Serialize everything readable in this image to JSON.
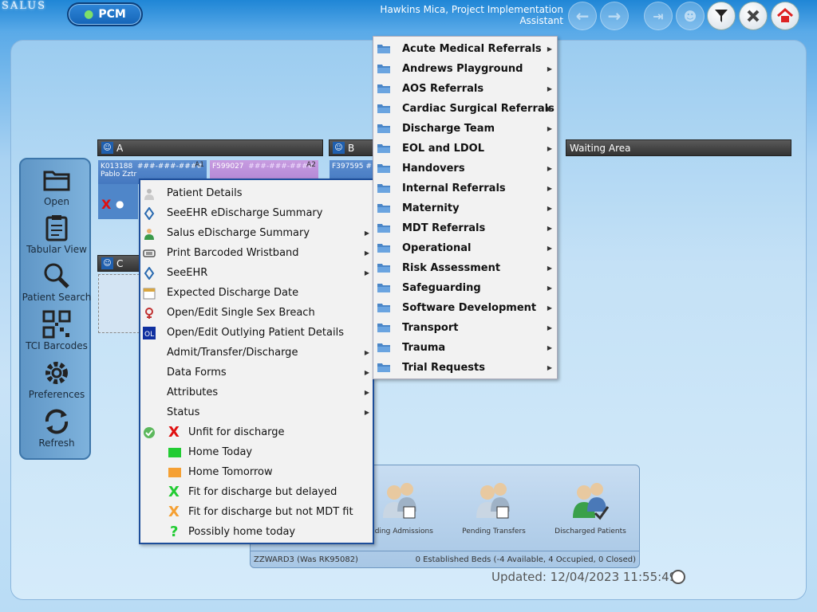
{
  "app": {
    "logo": "SALUS",
    "pcm_label": "PCM"
  },
  "header": {
    "user_title": "Hawkins Mica, Project Implementation Assistant"
  },
  "nav": [
    {
      "label": "Open",
      "icon": "folder-icon"
    },
    {
      "label": "Tabular View",
      "icon": "clipboard-icon"
    },
    {
      "label": "Patient Search",
      "icon": "magnifier-icon"
    },
    {
      "label": "TCI Barcodes",
      "icon": "qr-code-icon"
    },
    {
      "label": "Preferences",
      "icon": "gear-icon"
    },
    {
      "label": "Refresh",
      "icon": "refresh-icon"
    }
  ],
  "sections": {
    "a": "A",
    "b": "B",
    "c": "C",
    "waiting": "Waiting Area"
  },
  "beds": [
    {
      "id": "K013188",
      "nhs": "###-###-####",
      "name": "Pablo Zztr",
      "code": "A1"
    },
    {
      "id": "F599027",
      "nhs": "###-###-####",
      "code": "A2"
    },
    {
      "id": "F397595",
      "nhs": "#"
    }
  ],
  "context_menu": [
    {
      "label": "Patient Details",
      "icon": "person-icon",
      "submenu": false
    },
    {
      "label": "SeeEHR eDischarge Summary",
      "icon": "seeehr-icon",
      "submenu": false
    },
    {
      "label": "Salus eDischarge Summary",
      "icon": "salus-user-icon",
      "submenu": true
    },
    {
      "label": "Print Barcoded Wristband",
      "icon": "wristband-icon",
      "submenu": true
    },
    {
      "label": "SeeEHR",
      "icon": "seeehr-icon",
      "submenu": true
    },
    {
      "label": "Expected Discharge Date",
      "icon": "calendar-icon",
      "submenu": false
    },
    {
      "label": "Open/Edit Single Sex Breach",
      "icon": "gender-icon",
      "submenu": false
    },
    {
      "label": "Open/Edit Outlying Patient Details",
      "icon": "outlier-icon",
      "submenu": false
    },
    {
      "label": "Admit/Transfer/Discharge",
      "icon": "",
      "submenu": true
    },
    {
      "label": "Data Forms",
      "icon": "",
      "submenu": true
    },
    {
      "label": "Attributes",
      "icon": "",
      "submenu": true
    },
    {
      "label": "Status",
      "icon": "",
      "submenu": true
    }
  ],
  "status_items": [
    {
      "label": "Unfit for discharge",
      "glyph": "X",
      "color": "#e01010",
      "checked": true
    },
    {
      "label": "Home Today",
      "glyph": "",
      "color": "#22cc33",
      "checked": false
    },
    {
      "label": "Home Tomorrow",
      "glyph": "",
      "color": "#f5a033",
      "checked": false
    },
    {
      "label": "Fit for discharge but delayed",
      "glyph": "X",
      "color": "#22cc33",
      "checked": false
    },
    {
      "label": "Fit for discharge but not MDT fit",
      "glyph": "X",
      "color": "#f5a033",
      "checked": false
    },
    {
      "label": "Possibly home today",
      "glyph": "?",
      "color": "#22cc33",
      "checked": false
    }
  ],
  "forms_menu": [
    "Acute Medical Referrals",
    "Andrews Playground",
    "AOS Referrals",
    "Cardiac Surgical Referrals",
    "Discharge  Team",
    "EOL and LDOL",
    "Handovers",
    "Internal Referrals",
    "Maternity",
    "MDT Referrals",
    "Operational",
    "Risk Assessment",
    "Safeguarding",
    "Software Development",
    "Transport",
    "Trauma",
    "Trial Requests"
  ],
  "bottom": {
    "items": [
      "nding Admissions",
      "Pending Transfers",
      "Discharged Patients"
    ],
    "ward": "ZZWARD3 (Was RK95082)",
    "beds_summary": "0 Established Beds (-4 Available, 4 Occupied, 0 Closed)"
  },
  "updated": "Updated: 12/04/2023 11:55:49",
  "colors": {
    "menu_border": "#1d4e9a",
    "header_bg": "#333333",
    "panel_bg": "#c4e1f6"
  }
}
